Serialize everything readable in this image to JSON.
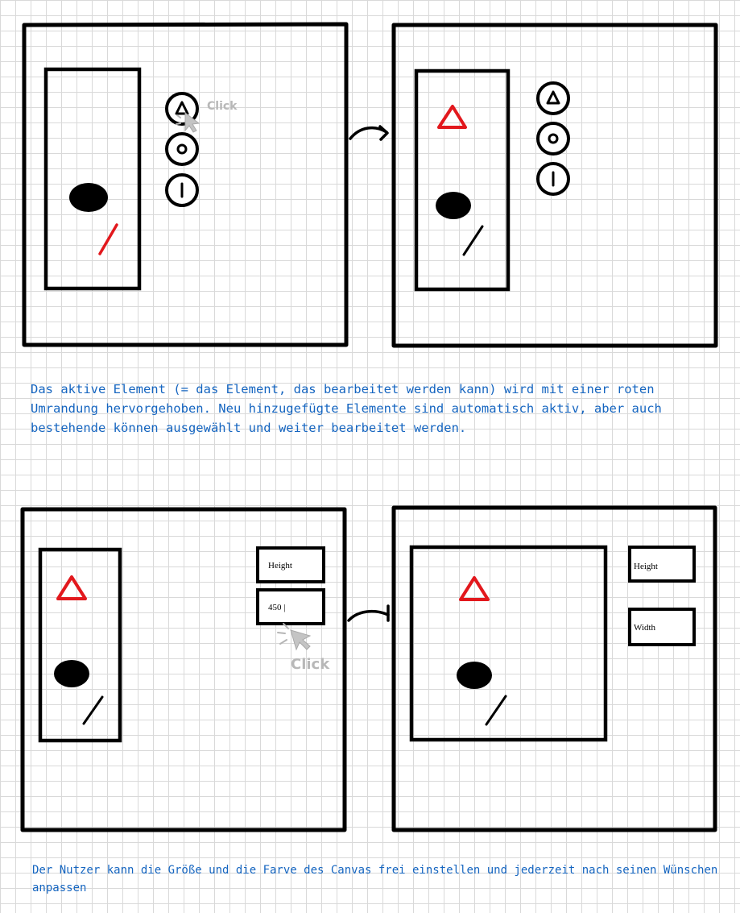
{
  "panels": [
    {
      "tools": [
        {
          "icon": "triangle-icon",
          "label": "Triangle"
        },
        {
          "icon": "circle-icon",
          "label": "Circle"
        },
        {
          "icon": "line-icon",
          "label": "Line"
        }
      ],
      "click_label": "Click"
    },
    {
      "tools": [
        {
          "icon": "triangle-icon"
        },
        {
          "icon": "circle-icon"
        },
        {
          "icon": "line-icon"
        }
      ]
    },
    {
      "fields": [
        {
          "value": "Height"
        },
        {
          "value": "450 |"
        }
      ],
      "click_label": "Click"
    },
    {
      "fields": [
        {
          "value": "Height"
        },
        {
          "value": "Width"
        }
      ]
    }
  ],
  "descriptions": {
    "top": "Das aktive Element (= das Element, das bearbeitet werden kann) wird mit einer roten Umrandung hervorgehoben. Neu hinzugefügte Elemente sind automatisch aktiv, aber auch bestehende können ausgewählt und weiter bearbeitet werden.",
    "bottom": "Der Nutzer kann die Größe und die Farve des Canvas frei einstellen und jederzeit nach seinen Wünschen anpassen"
  },
  "colors": {
    "active_element": "#e2181d",
    "description_text": "#1565c0",
    "cursor": "#c4c4c4",
    "grid": "#d9d9d9"
  }
}
